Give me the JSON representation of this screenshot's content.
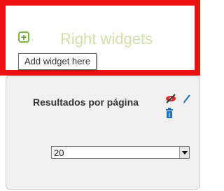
{
  "header": {
    "title": "Right widgets",
    "add_icon": "plus-icon"
  },
  "tooltip": {
    "text": "Add widget here"
  },
  "widget": {
    "title": "Resultados por página",
    "icons": [
      "hide-icon",
      "edit-icon",
      "delete-icon"
    ],
    "select": {
      "value": "20"
    }
  },
  "colors": {
    "frame_border": "#ee1111",
    "title": "#cfe1a9",
    "icon_green": "#7fb441",
    "icon_blue": "#1e6fc0",
    "icon_red": "#c81e1e"
  }
}
